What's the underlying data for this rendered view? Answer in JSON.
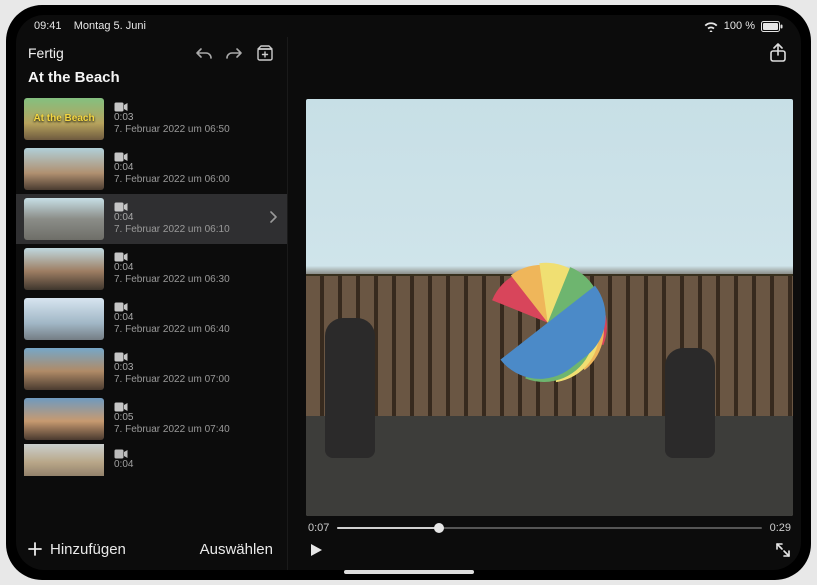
{
  "status": {
    "time": "09:41",
    "date": "Montag 5. Juni",
    "battery_text": "100 %"
  },
  "header": {
    "done_label": "Fertig",
    "project_title": "At the Beach"
  },
  "sidebar": {
    "bottom_add_label": "Hinzufügen",
    "bottom_select_label": "Auswählen"
  },
  "clips": [
    {
      "title_overlay": "At the Beach",
      "duration": "0:03",
      "timestamp": "7. Februar 2022 um 06:50",
      "selected": false,
      "thumb_bg": "linear-gradient(#84c080,#b7a35d 60%,#6e5a3f)"
    },
    {
      "duration": "0:04",
      "timestamp": "7. Februar 2022 um 06:00",
      "selected": false,
      "thumb_bg": "linear-gradient(#b0cfd8,#b09070 60%,#4a3c30)"
    },
    {
      "duration": "0:04",
      "timestamp": "7. Februar 2022 um 06:10",
      "selected": true,
      "thumb_bg": "linear-gradient(#c7dfe6,#8b8d88 50%,#6e6e68)"
    },
    {
      "duration": "0:04",
      "timestamp": "7. Februar 2022 um 06:30",
      "selected": false,
      "thumb_bg": "linear-gradient(#bfd8df,#9e7e63 55%,#3f362d)"
    },
    {
      "duration": "0:04",
      "timestamp": "7. Februar 2022 um 06:40",
      "selected": false,
      "thumb_bg": "linear-gradient(#d7e5f0,#a1b7c6 60%,#747d84)"
    },
    {
      "duration": "0:03",
      "timestamp": "7. Februar 2022 um 07:00",
      "selected": false,
      "thumb_bg": "linear-gradient(#76a7c8,#b08b67 55%,#4b3c30)"
    },
    {
      "duration": "0:05",
      "timestamp": "7. Februar 2022 um 07:40",
      "selected": false,
      "thumb_bg": "linear-gradient(#6f9abf,#c79a70 55%,#4a3a2f)"
    },
    {
      "duration": "0:04",
      "timestamp": "",
      "selected": false,
      "thumb_bg": "linear-gradient(#d9e6ee,#c3b090 55%,#8c7a66)"
    }
  ],
  "preview": {
    "current_time": "0:07",
    "total_time": "0:29",
    "progress_pct": 24
  }
}
